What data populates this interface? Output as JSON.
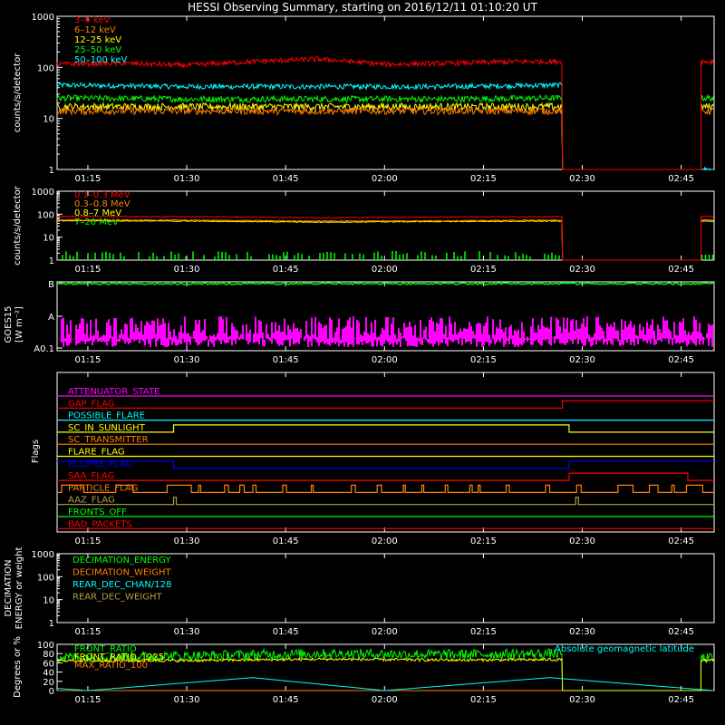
{
  "title": "HESSI Observing Summary, starting on 2016/12/11 01:10:20 UT",
  "time_ticks": [
    "01:15",
    "01:30",
    "01:45",
    "02:00",
    "02:15",
    "02:30",
    "02:45"
  ],
  "colors": {
    "red": "#ff0000",
    "orange": "#ff8000",
    "yellow": "#ffff00",
    "green": "#00ff00",
    "cyan": "#00ffff",
    "magenta": "#ff00ff",
    "blue": "#0000ff",
    "olive": "#b0a040",
    "white": "#ffffff"
  },
  "chart_data": [
    {
      "id": "panel1",
      "type": "line",
      "ylabel": "counts/s/detector",
      "ytick_labels": [
        "1",
        "10",
        "100",
        "1000"
      ],
      "y_scale": "log",
      "ylim": [
        1,
        1000
      ],
      "xlim": [
        "01:10:20",
        "02:50:00"
      ],
      "data_gap": [
        "02:27",
        "02:48"
      ],
      "series": [
        {
          "name": "3–6 keV",
          "color": "#ff0000",
          "x": [
            "01:10",
            "01:20",
            "01:30",
            "01:40",
            "01:50",
            "02:00",
            "02:10",
            "02:20",
            "02:27"
          ],
          "y": [
            115,
            120,
            110,
            130,
            145,
            115,
            120,
            130,
            130
          ],
          "after_gap": 130
        },
        {
          "name": "6–12 keV",
          "color": "#ff8000",
          "x": [
            "01:10",
            "01:30",
            "01:50",
            "02:10",
            "02:27"
          ],
          "y": [
            14,
            14,
            14,
            14,
            14
          ],
          "after_gap": 14
        },
        {
          "name": "12–25 keV",
          "color": "#ffff00",
          "x": [
            "01:10",
            "01:30",
            "01:50",
            "02:10",
            "02:27"
          ],
          "y": [
            17,
            17,
            17,
            17,
            17
          ],
          "after_gap": 17
        },
        {
          "name": "25–50 keV",
          "color": "#00ff00",
          "x": [
            "01:10",
            "01:30",
            "01:50",
            "02:10",
            "02:27"
          ],
          "y": [
            25,
            24,
            24,
            24,
            25
          ],
          "after_gap": 25
        },
        {
          "name": "50–100 keV",
          "color": "#00ffff",
          "x": [
            "01:10",
            "01:30",
            "01:50",
            "02:10",
            "02:27"
          ],
          "y": [
            45,
            42,
            42,
            42,
            45
          ],
          "after_gap": 1
        }
      ]
    },
    {
      "id": "panel2",
      "type": "line",
      "ylabel": "counts/s/detector",
      "ytick_labels": [
        "1",
        "10",
        "100",
        "1000"
      ],
      "y_scale": "log",
      "ylim": [
        1,
        1000
      ],
      "data_gap": [
        "02:27",
        "02:48"
      ],
      "series": [
        {
          "name": "0.1–0.3 MeV",
          "color": "#ff0000",
          "x": [
            "01:10",
            "01:30",
            "01:50",
            "02:10",
            "02:27"
          ],
          "y": [
            80,
            78,
            70,
            75,
            78
          ],
          "after_gap": 80
        },
        {
          "name": "0.3–0.8 MeV",
          "color": "#ff8000",
          "x": [
            "01:10",
            "01:30",
            "01:50",
            "02:10",
            "02:27"
          ],
          "y": [
            55,
            55,
            50,
            52,
            55
          ],
          "after_gap": 55
        },
        {
          "name": "0.8–7 MeV",
          "color": "#ffff00",
          "x": [
            "01:10",
            "01:30",
            "01:50",
            "02:10",
            "02:27"
          ],
          "y": [
            52,
            50,
            45,
            48,
            50
          ],
          "after_gap": 50
        },
        {
          "name": "7–20 MeV",
          "color": "#00ff00",
          "x": [
            "01:10",
            "01:30",
            "01:50",
            "02:10",
            "02:27"
          ],
          "y": [
            1,
            1,
            1,
            1,
            1
          ],
          "after_gap": 1
        }
      ]
    },
    {
      "id": "panel3",
      "type": "line",
      "ylabel": "GOES15",
      "ylabel_unit": "[W m⁻²]",
      "ytick_labels": [
        "A0.1",
        "A",
        "B"
      ],
      "series": [
        {
          "name": "GOES long",
          "color": "#00ff00",
          "level": "B"
        },
        {
          "name": "GOES short",
          "color": "#ff00ff",
          "level": "A0.1–A"
        }
      ]
    },
    {
      "id": "flags",
      "type": "line",
      "ylabel": "Flags",
      "flags": [
        {
          "name": "ATTENUATOR_STATE",
          "color": "#ff00ff",
          "state": "off"
        },
        {
          "name": "GAP_FLAG",
          "color": "#ff0000",
          "state": "on from 02:27"
        },
        {
          "name": "POSSIBLE_FLARE",
          "color": "#00ffff",
          "state": "off"
        },
        {
          "name": "SC_IN_SUNLIGHT",
          "color": "#ffff00",
          "state": "on 01:28–02:28"
        },
        {
          "name": "SC_TRANSMITTER",
          "color": "#ff8000",
          "state": "off"
        },
        {
          "name": "FLARE_FLAG",
          "color": "#ffff00",
          "state": "off"
        },
        {
          "name": "ECLIPSE_FLAG",
          "color": "#0000ff",
          "state": "on before 01:28 and after 02:28"
        },
        {
          "name": "SAA_FLAG",
          "color": "#ff0000",
          "state": "on 02:28–02:46"
        },
        {
          "name": "PARTICLE_FLAG",
          "color": "#ff8000",
          "state": "intermittent"
        },
        {
          "name": "AAZ_FLAG",
          "color": "#b0a040",
          "state": "brief pulses"
        },
        {
          "name": "FRONTS_OFF",
          "color": "#00ff00",
          "state": "off"
        },
        {
          "name": "BAD_PACKETS",
          "color": "#ff0000",
          "state": "off"
        }
      ]
    },
    {
      "id": "decimation",
      "type": "line",
      "ylabel_lines": [
        "DECIMATION",
        "ENERGY or weight"
      ],
      "ytick_labels": [
        "1",
        "10",
        "100",
        "1000"
      ],
      "y_scale": "log",
      "ylim": [
        1,
        1000
      ],
      "series": [
        {
          "name": "DECIMATION_ENERGY",
          "color": "#00ff00"
        },
        {
          "name": "DECIMATION_WEIGHT",
          "color": "#ff8000"
        },
        {
          "name": "REAR_DEC_CHAN/128",
          "color": "#00ffff"
        },
        {
          "name": "REAR_DEC_WEIGHT",
          "color": "#b0a040"
        }
      ]
    },
    {
      "id": "ratio",
      "type": "line",
      "ylabel": "Degrees or %",
      "ytick_labels": [
        "0",
        "20",
        "40",
        "60",
        "80",
        "100"
      ],
      "ylim": [
        0,
        100
      ],
      "annotation": "Absolute geomagnetic latitude",
      "series": [
        {
          "name": "FRONT_RATIO",
          "color": "#00ff00",
          "x": [
            "01:10",
            "01:30",
            "01:50",
            "02:10",
            "02:27"
          ],
          "y": [
            72,
            75,
            80,
            78,
            80
          ],
          "after_gap": 70
        },
        {
          "name": "FRONT_RATIO_1225",
          "color": "#ffff00",
          "x": [
            "01:10",
            "01:30",
            "01:50",
            "02:10",
            "02:27"
          ],
          "y": [
            65,
            65,
            68,
            66,
            67
          ],
          "after_gap": 65
        },
        {
          "name": "MAX_RATIO_100",
          "color": "#ff8000",
          "x": [
            "01:10",
            "01:30",
            "01:50",
            "02:10",
            "02:27"
          ],
          "y": [
            0,
            0,
            0,
            0,
            0
          ],
          "after_gap": 0
        },
        {
          "name": "Absolute geomagnetic latitude",
          "color": "#00ffff",
          "x": [
            "01:10",
            "01:15",
            "01:40",
            "02:00",
            "02:25",
            "02:50"
          ],
          "y": [
            5,
            0,
            28,
            0,
            28,
            0
          ]
        }
      ]
    }
  ]
}
